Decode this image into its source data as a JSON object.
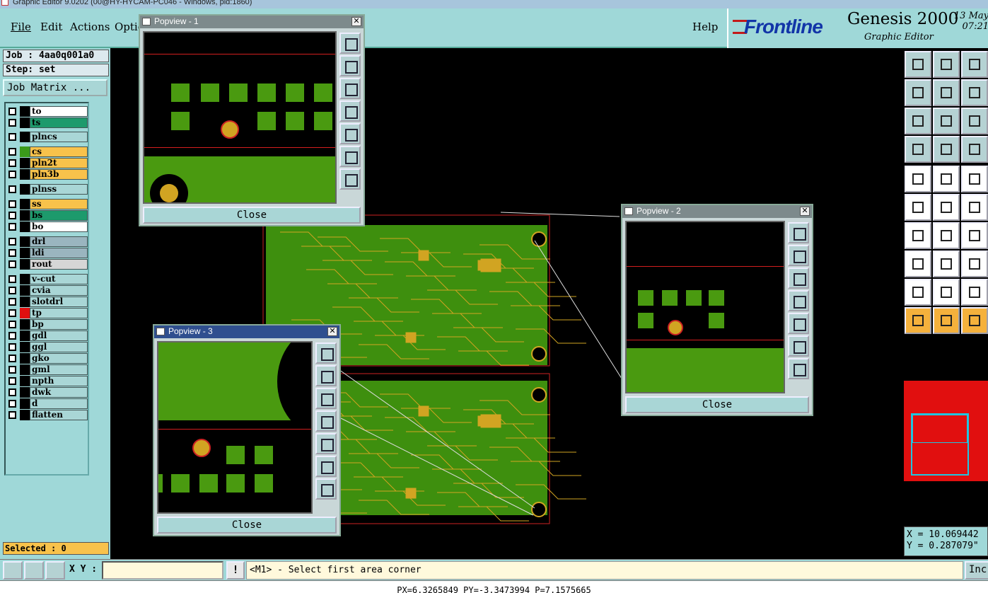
{
  "window": {
    "title": "Graphic Editor 9.0202 (00@HY-HYCAM-PC046 - Windows, pid:1860)"
  },
  "menu": {
    "items": [
      "File",
      "Edit",
      "Actions",
      "Optio",
      "Help"
    ]
  },
  "brand": {
    "logo": "Frontline",
    "product": "Genesis 2000",
    "subtitle": "Graphic Editor",
    "date": "13 May",
    "time": "07:21"
  },
  "job": {
    "job_line": "Job : 4aa0q001a0",
    "step_line": "Step: set",
    "matrix_button": "Job Matrix ..."
  },
  "layers": [
    {
      "name": "to",
      "color": "#ffffff",
      "swatch": "#000000"
    },
    {
      "name": "ts",
      "color": "#1d9a6c",
      "swatch": "#000000"
    },
    {
      "name": "plncs",
      "color": "#a9d6d6",
      "swatch": "#000000"
    },
    {
      "name": "cs",
      "color": "#f8c24b",
      "swatch": "#3a9a1a"
    },
    {
      "name": "pln2t",
      "color": "#f8c24b",
      "swatch": "#000000"
    },
    {
      "name": "pln3b",
      "color": "#f8c24b",
      "swatch": "#000000"
    },
    {
      "name": "plnss",
      "color": "#a9d6d6",
      "swatch": "#000000"
    },
    {
      "name": "ss",
      "color": "#f8c24b",
      "swatch": "#000000"
    },
    {
      "name": "bs",
      "color": "#1d9a6c",
      "swatch": "#000000"
    },
    {
      "name": "bo",
      "color": "#ffffff",
      "swatch": "#000000"
    },
    {
      "name": "drl",
      "color": "#9ab5bf",
      "swatch": "#000000"
    },
    {
      "name": "ldi",
      "color": "#9ab5bf",
      "swatch": "#000000"
    },
    {
      "name": "rout",
      "color": "#d6d6d6",
      "swatch": "#000000"
    },
    {
      "name": "v-cut",
      "color": "#a9d6d6",
      "swatch": "#000000"
    },
    {
      "name": "cvia",
      "color": "#a9d6d6",
      "swatch": "#000000"
    },
    {
      "name": "slotdrl",
      "color": "#a9d6d6",
      "swatch": "#000000"
    },
    {
      "name": "tp",
      "color": "#a9d6d6",
      "swatch": "#e01010"
    },
    {
      "name": "bp",
      "color": "#a9d6d6",
      "swatch": "#000000"
    },
    {
      "name": "gdl",
      "color": "#a9d6d6",
      "swatch": "#000000"
    },
    {
      "name": "ggl",
      "color": "#a9d6d6",
      "swatch": "#000000"
    },
    {
      "name": "gko",
      "color": "#a9d6d6",
      "swatch": "#000000"
    },
    {
      "name": "gml",
      "color": "#a9d6d6",
      "swatch": "#000000"
    },
    {
      "name": "npth",
      "color": "#a9d6d6",
      "swatch": "#000000"
    },
    {
      "name": "dwk",
      "color": "#a9d6d6",
      "swatch": "#000000"
    },
    {
      "name": "d",
      "color": "#a9d6d6",
      "swatch": "#000000"
    },
    {
      "name": "flatten",
      "color": "#a9d6d6",
      "swatch": "#000000"
    }
  ],
  "selected": "Selected : 0",
  "popviews": [
    {
      "title": "Popview - 1",
      "close": "Close"
    },
    {
      "title": "Popview - 2",
      "close": "Close"
    },
    {
      "title": "Popview - 3",
      "close": "Close"
    }
  ],
  "coords": {
    "x": "X = 10.069442",
    "y": "Y = 0.287079\""
  },
  "bottom": {
    "xy_label": "X Y :",
    "xy_value": "",
    "warn": "!",
    "prompt": "<M1> - Select first area corner",
    "inc": "Inc"
  },
  "status": "PX=6.3265849 PY=-3.3473994 P=7.1575665"
}
